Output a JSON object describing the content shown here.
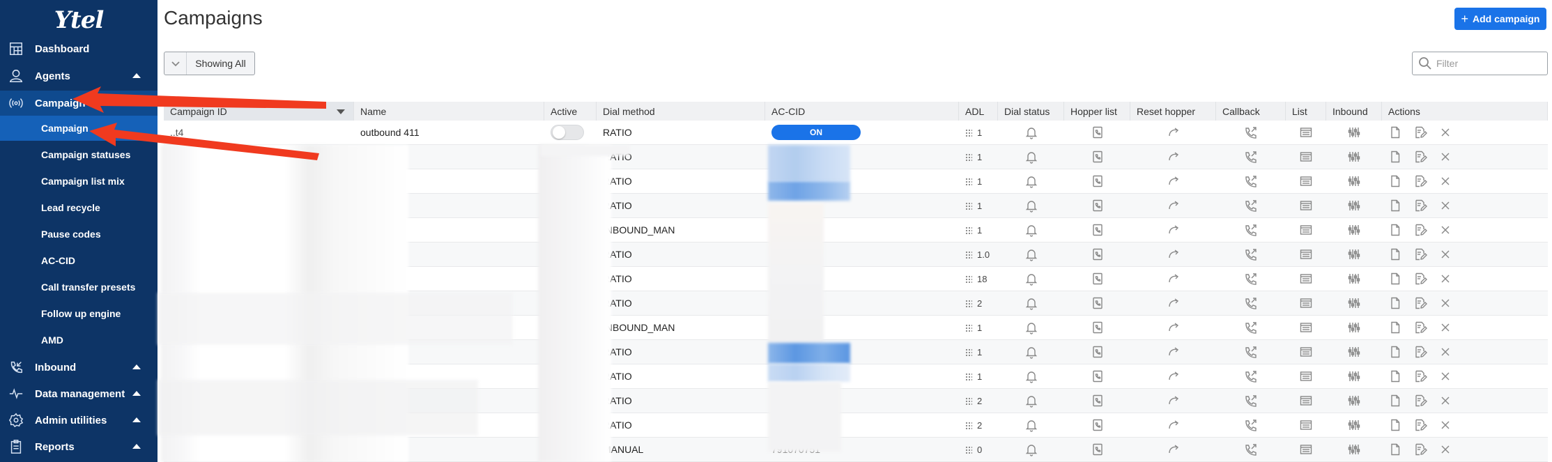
{
  "app": {
    "logo_text": "Ytel"
  },
  "sidebar": {
    "items": [
      {
        "label": "Dashboard",
        "icon": "dashboard-icon"
      },
      {
        "label": "Agents",
        "icon": "agents-icon"
      },
      {
        "label": "Campaign",
        "icon": "broadcast-icon"
      },
      {
        "label": "Inbound",
        "icon": "phone-incoming-icon"
      },
      {
        "label": "Data management",
        "icon": "pulse-icon"
      },
      {
        "label": "Admin utilities",
        "icon": "gear-icon"
      },
      {
        "label": "Reports",
        "icon": "clipboard-icon"
      }
    ],
    "subitems": [
      {
        "label": "Campaign"
      },
      {
        "label": "Campaign statuses"
      },
      {
        "label": "Campaign list mix"
      },
      {
        "label": "Lead recycle"
      },
      {
        "label": "Pause codes"
      },
      {
        "label": "AC-CID"
      },
      {
        "label": "Call transfer presets"
      },
      {
        "label": "Follow up engine"
      },
      {
        "label": "AMD"
      }
    ]
  },
  "header": {
    "title": "Campaigns",
    "add_label": "Add campaign"
  },
  "toolbar": {
    "showing_label": "Showing All",
    "filter_placeholder": "Filter"
  },
  "table": {
    "columns": [
      "Campaign ID",
      "Name",
      "Active",
      "Dial method",
      "AC-CID",
      "ADL",
      "Dial status",
      "Hopper list",
      "Reset hopper",
      "Callback",
      "List",
      "Inbound",
      "Actions"
    ],
    "rows": [
      {
        "id": "..t4",
        "name": "outbound 411",
        "active": false,
        "dial_method": "RATIO",
        "accid": "ON",
        "adl": "1"
      },
      {
        "id": "",
        "name": "",
        "active": true,
        "dial_method": "RATIO",
        "accid": "",
        "adl": "1"
      },
      {
        "id": "",
        "name": "",
        "active": true,
        "dial_method": "RATIO",
        "accid": "",
        "adl": "1"
      },
      {
        "id": "",
        "name": "",
        "active": true,
        "dial_method": "RATIO",
        "accid": "",
        "adl": "1"
      },
      {
        "id": "",
        "name": "",
        "active": true,
        "dial_method": "INBOUND_MAN",
        "accid": "",
        "adl": "1"
      },
      {
        "id": "",
        "name": "",
        "active": true,
        "dial_method": "RATIO",
        "accid": "",
        "adl": "1.0"
      },
      {
        "id": "",
        "name": "",
        "active": true,
        "dial_method": "RATIO",
        "accid": "",
        "adl": "18"
      },
      {
        "id": "",
        "name": "",
        "active": false,
        "dial_method": "RATIO",
        "accid": "",
        "adl": "2"
      },
      {
        "id": "",
        "name": "",
        "active": true,
        "dial_method": "INBOUND_MAN",
        "accid": "",
        "adl": "1"
      },
      {
        "id": "",
        "name": "",
        "active": true,
        "dial_method": "RATIO",
        "accid": "",
        "adl": "1"
      },
      {
        "id": "",
        "name": "",
        "active": true,
        "dial_method": "RATIO",
        "accid": "",
        "adl": "1"
      },
      {
        "id": "",
        "name": "",
        "active": true,
        "dial_method": "RATIO",
        "accid": "",
        "adl": "2"
      },
      {
        "id": "",
        "name": "",
        "active": true,
        "dial_method": "RATIO",
        "accid": "",
        "adl": "2"
      },
      {
        "id": "",
        "name": "",
        "active": false,
        "dial_method": "MANUAL",
        "accid": "791070751",
        "adl": "0"
      }
    ]
  },
  "colors": {
    "sidebar_bg": "#0d3466",
    "sidebar_active": "#0f4a8e",
    "sub_active": "#1561b8",
    "accent": "#1a73e8",
    "arrow": "#f03a1f"
  }
}
